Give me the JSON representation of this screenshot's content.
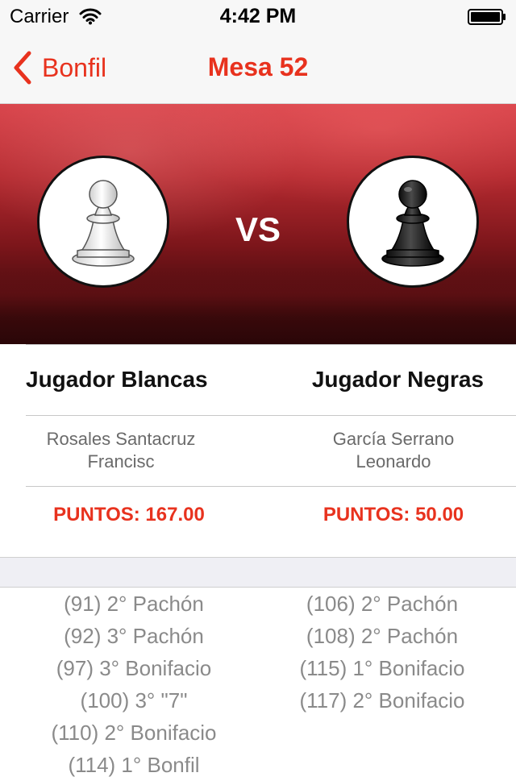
{
  "status_bar": {
    "carrier": "Carrier",
    "time": "4:42 PM"
  },
  "nav": {
    "back_label": "Bonfil",
    "title": "Mesa 52",
    "accent_color": "#e8321e"
  },
  "hero": {
    "vs_label": "VS",
    "white_piece_icon": "white-pawn-icon",
    "black_piece_icon": "black-pawn-icon"
  },
  "players": {
    "white": {
      "heading": "Jugador Blancas",
      "name_line1": "Rosales Santacruz",
      "name_line2": "Francisc",
      "points": "PUNTOS: 167.00"
    },
    "black": {
      "heading": "Jugador Negras",
      "name_line1": "García Serrano",
      "name_line2": "Leonardo",
      "points": "PUNTOS: 50.00"
    }
  },
  "history": {
    "white": [
      "(91) 2° Pachón",
      "(92) 3° Pachón",
      "(97) 3° Bonifacio",
      "(100) 3° \"7\"",
      "(110) 2° Bonifacio",
      "(114) 1° Bonfil"
    ],
    "black": [
      "(106) 2° Pachón",
      "(108) 2° Pachón",
      "(115) 1° Bonifacio",
      "(117) 2° Bonifacio"
    ]
  }
}
